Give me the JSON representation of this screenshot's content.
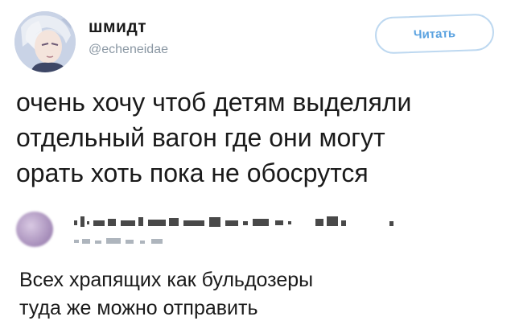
{
  "tweet": {
    "author": {
      "display_name": "шмидт",
      "handle": "@echeneidae",
      "avatar_icon": "anime-character-avatar"
    },
    "follow_label": "Читать",
    "text_lines": [
      "очень хочу чтоб детям выделяли",
      "отдельный вагон где они могут",
      "орать хоть пока не обосрутся"
    ]
  },
  "reply": {
    "author_redacted": true,
    "text_lines": [
      "Всех храпящих как бульдозеры",
      "туда же можно отправить"
    ]
  },
  "colors": {
    "follow_accent": "#5aa2e0",
    "follow_border": "#bdd8f0",
    "handle_gray": "#8a97a3",
    "text": "#1a1a1a"
  }
}
